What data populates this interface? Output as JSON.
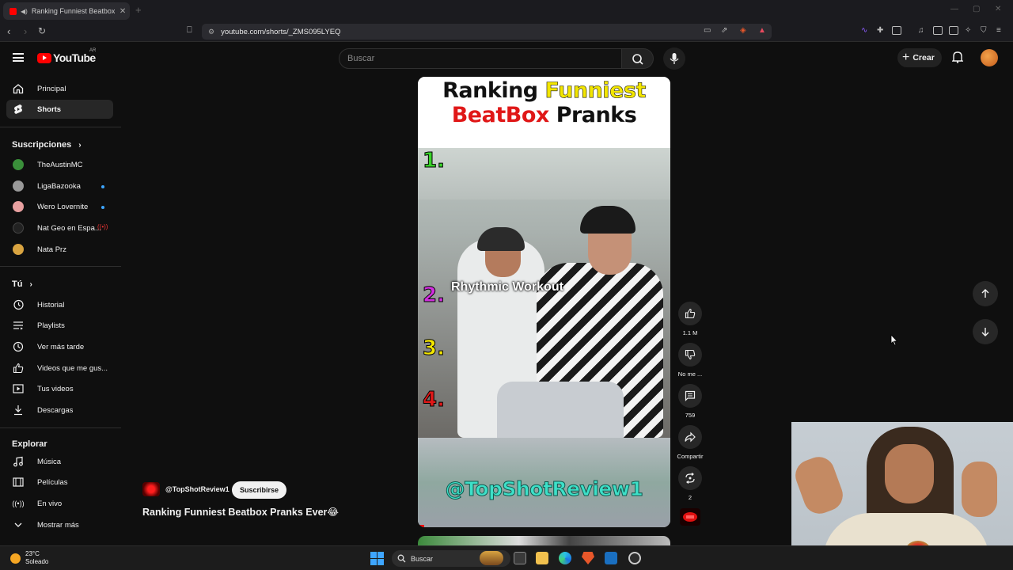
{
  "browser": {
    "tab_title": "Ranking Funniest Beatbox Pr",
    "url": "youtube.com/shorts/_ZMS095LYEQ"
  },
  "header": {
    "logo_text": "YouTube",
    "country_code": "AR",
    "search_placeholder": "Buscar",
    "create_label": "Crear"
  },
  "sidebar": {
    "main": [
      {
        "label": "Principal",
        "icon": "home-icon"
      },
      {
        "label": "Shorts",
        "icon": "shorts-icon",
        "active": true
      }
    ],
    "subscriptions_title": "Suscripciones",
    "subscriptions": [
      {
        "label": "TheAustinMC",
        "color": "#3a8f3a"
      },
      {
        "label": "LigaBazooka",
        "color": "#999999",
        "new": true
      },
      {
        "label": "Wero Lovernite",
        "color": "#e8a0a0",
        "new": true
      },
      {
        "label": "Nat Geo en Espa...",
        "color": "#222222",
        "live": true
      },
      {
        "label": "Nata Prz",
        "color": "#d9a441"
      }
    ],
    "you_title": "Tú",
    "you": [
      {
        "label": "Historial",
        "icon": "history-icon"
      },
      {
        "label": "Playlists",
        "icon": "playlist-icon"
      },
      {
        "label": "Ver más tarde",
        "icon": "clock-icon"
      },
      {
        "label": "Videos que me gus...",
        "icon": "thumbs-up-icon"
      },
      {
        "label": "Tus videos",
        "icon": "video-icon"
      },
      {
        "label": "Descargas",
        "icon": "download-icon"
      }
    ],
    "explore_title": "Explorar",
    "explore": [
      {
        "label": "Música",
        "icon": "music-icon"
      },
      {
        "label": "Películas",
        "icon": "film-icon"
      },
      {
        "label": "En vivo",
        "icon": "live-icon"
      },
      {
        "label": "Mostrar más",
        "icon": "chevron-down-icon"
      }
    ]
  },
  "short": {
    "title_line1_a": "Ranking",
    "title_line1_b": "Funniest",
    "title_line2_a": "BeatBox",
    "title_line2_b": "Pranks",
    "ranks": [
      "1.",
      "2.",
      "3.",
      "4."
    ],
    "rank2_caption": "Rhythmic Workout",
    "watermark": "@TopShotReview1",
    "progress": 0.025
  },
  "actions": {
    "likes": "1.1 M",
    "dislike_label": "No me ...",
    "comments": "759",
    "share_label": "Compartir",
    "remix_count": "2"
  },
  "channel": {
    "handle": "@TopShotReview1",
    "subscribe_label": "Suscribirse",
    "video_title": "Ranking Funniest Beatbox Pranks Ever😂"
  },
  "taskbar": {
    "temp": "23°C",
    "weather": "Soleado",
    "search_label": "Buscar"
  }
}
